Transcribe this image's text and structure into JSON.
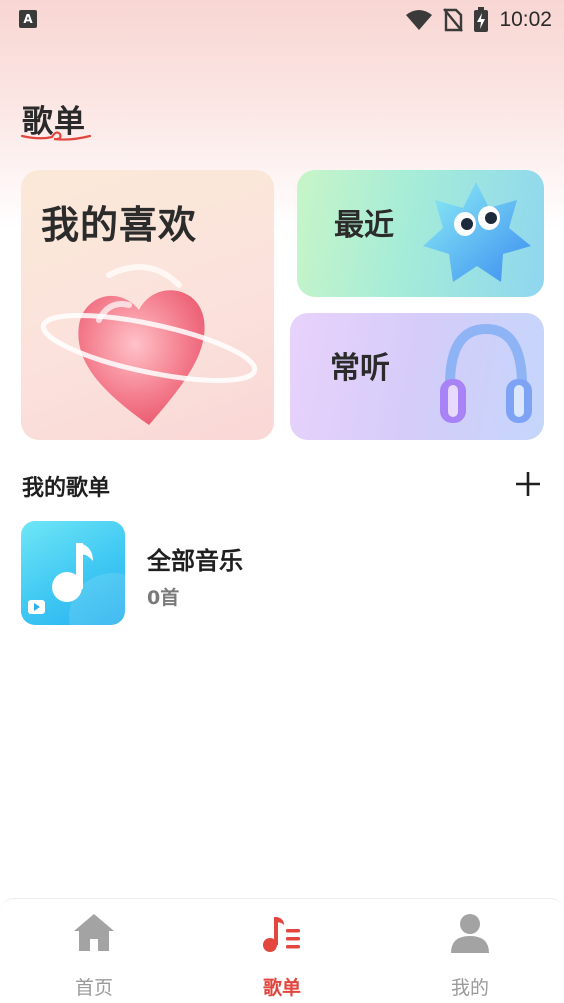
{
  "status_bar": {
    "app_icon_letter": "A",
    "time": "10:02",
    "icons": [
      "wifi-icon",
      "no-sim-icon",
      "battery-charging-icon"
    ]
  },
  "page": {
    "title": "歌单"
  },
  "cards": {
    "favorites": {
      "label": "我的喜欢",
      "icon": "heart-icon"
    },
    "recent": {
      "label": "最近",
      "icon": "star-mascot-icon"
    },
    "frequent": {
      "label": "常听",
      "icon": "headphones-icon"
    }
  },
  "my_playlists": {
    "title": "我的歌单",
    "add_icon": "plus-icon",
    "items": [
      {
        "name": "全部音乐",
        "count": "0首",
        "icon": "music-note-icon"
      }
    ]
  },
  "bottom_nav": {
    "items": [
      {
        "label": "首页",
        "icon": "home-icon",
        "active": false
      },
      {
        "label": "歌单",
        "icon": "playlist-icon",
        "active": true
      },
      {
        "label": "我的",
        "icon": "person-icon",
        "active": false
      }
    ]
  },
  "colors": {
    "accent": "#e2463f",
    "inactive": "#9a9a9a",
    "header_bg": "#f8d6d3"
  }
}
